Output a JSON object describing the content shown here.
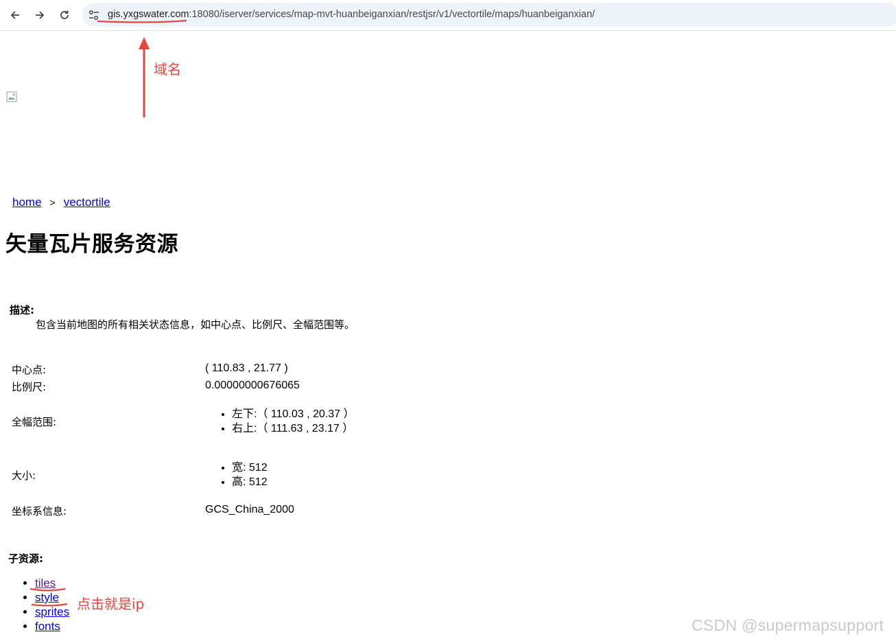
{
  "browser": {
    "url_host": "gis.yxgswater.com",
    "url_rest": ":18080/iserver/services/map-mvt-huanbeiganxian/restjsr/v1/vectortile/maps/huanbeiganxian/",
    "back_icon": "back-arrow-icon",
    "forward_icon": "forward-arrow-icon",
    "reload_icon": "reload-icon",
    "site_info_icon": "tune-icon"
  },
  "breadcrumb": {
    "home": "home",
    "separator": ">",
    "current": "vectortile"
  },
  "page": {
    "title": "矢量瓦片服务资源",
    "desc_label": "描述:",
    "desc_text": "包含当前地图的所有相关状态信息，如中心点、比例尺、全幅范围等。"
  },
  "info": {
    "center_label": "中心点:",
    "center_value": "( 110.83 , 21.77 )",
    "scale_label": "比例尺:",
    "scale_value": "0.00000000676065",
    "bounds_label": "全幅范围:",
    "bounds": [
      "左下:（ 110.03 , 20.37 ）",
      "右上:（ 111.63 , 23.17 ）"
    ],
    "size_label": "大小:",
    "size": [
      "宽: 512",
      "高: 512"
    ],
    "crs_label": "坐标系信息:",
    "crs_value": "GCS_China_2000"
  },
  "children": {
    "label": "子资源:",
    "links": [
      "tiles",
      "style",
      "sprites",
      "fonts"
    ]
  },
  "annotations": {
    "domain_note": "域名",
    "click_note": "点击就是ip",
    "color": "#e8463c"
  },
  "watermark": "CSDN @supermapsupport"
}
